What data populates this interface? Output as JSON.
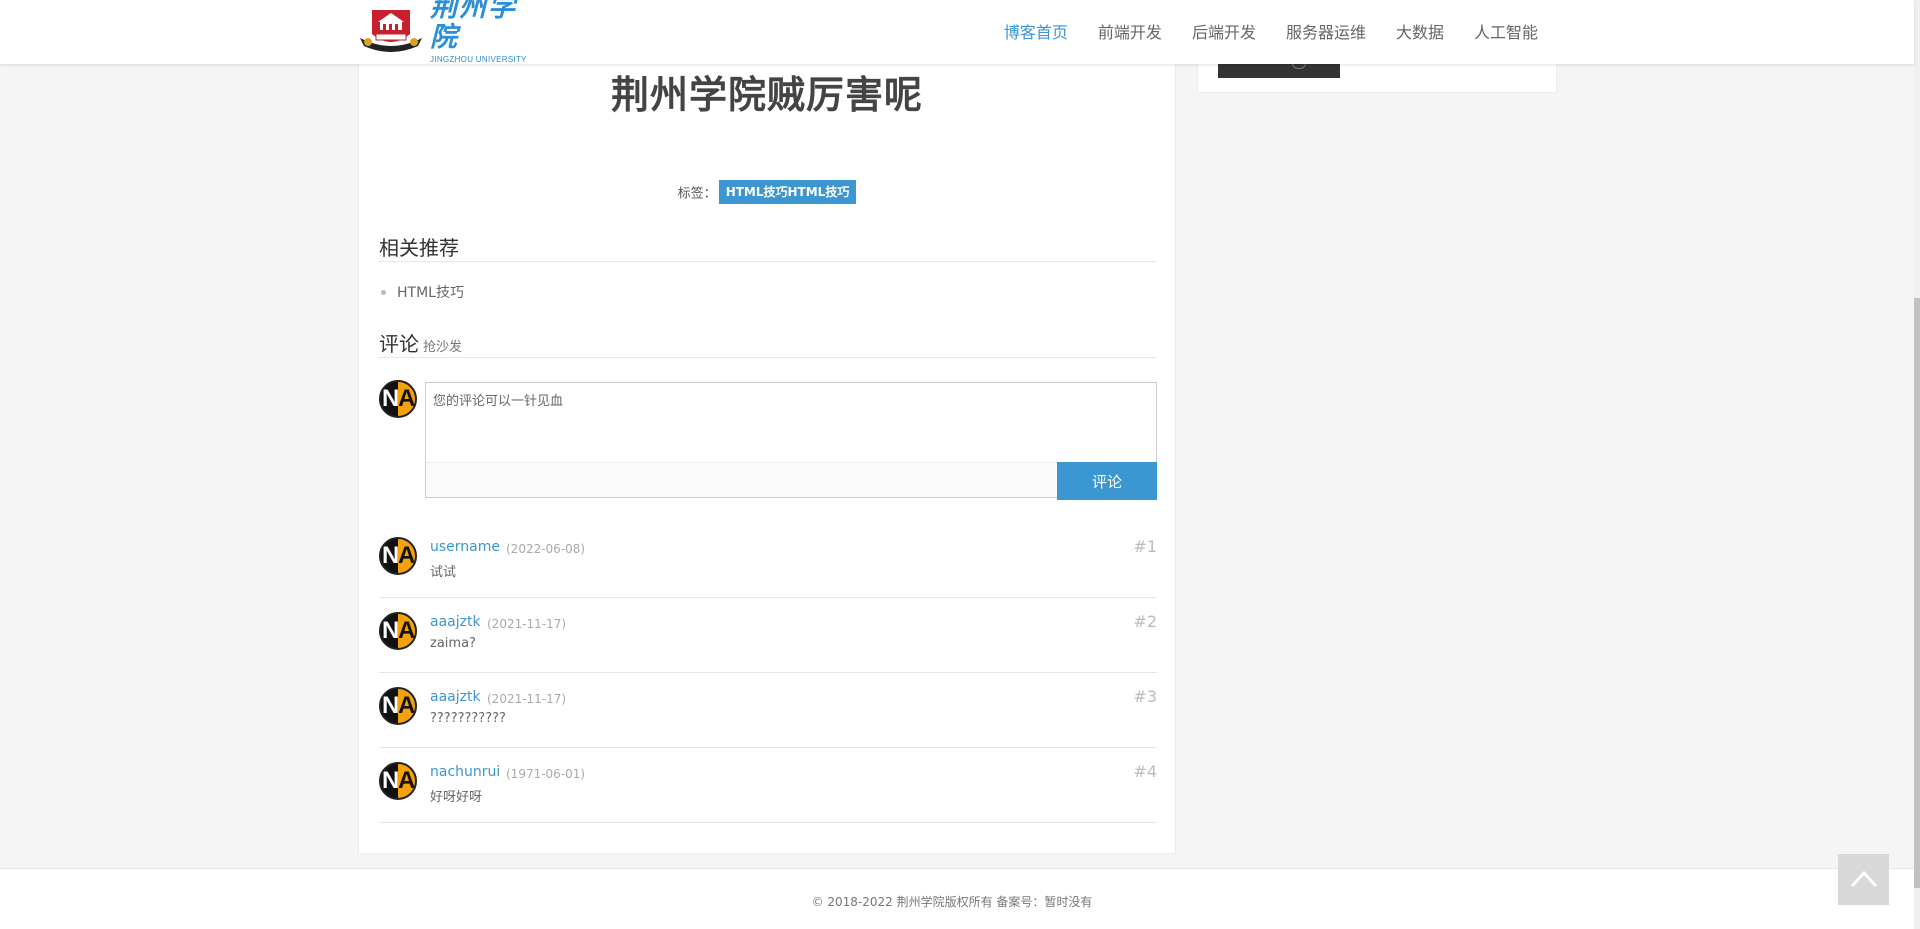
{
  "header": {
    "logo": {
      "cn": "荆州学院",
      "en": "JINGZHOU UNIVERSITY"
    },
    "nav": [
      {
        "label": "博客首页",
        "active": true
      },
      {
        "label": "前端开发",
        "active": false
      },
      {
        "label": "后端开发",
        "active": false
      },
      {
        "label": "服务器运维",
        "active": false
      },
      {
        "label": "大数据",
        "active": false
      },
      {
        "label": "人工智能",
        "active": false
      }
    ]
  },
  "article": {
    "title": "荆州学院贼厉害呢",
    "tags_label": "标签：",
    "tag": "HTML技巧HTML技巧"
  },
  "related": {
    "heading": "相关推荐",
    "items": [
      "HTML技巧"
    ]
  },
  "comments": {
    "heading": "评论",
    "subheading": "抢沙发",
    "placeholder": "您的评论可以一针见血",
    "submit_label": "评论",
    "avatar_text": {
      "n": "N",
      "a": "A"
    },
    "list": [
      {
        "user": "username",
        "date": "(2022-06-08)",
        "text": "试试",
        "num": "#1"
      },
      {
        "user": "aaajztk",
        "date": "(2021-11-17)",
        "text": "zaima?",
        "num": "#2"
      },
      {
        "user": "aaajztk",
        "date": "(2021-11-17)",
        "text": "???????????",
        "num": "#3"
      },
      {
        "user": "nachunrui",
        "date": "(1971-06-01)",
        "text": "好呀好呀",
        "num": "#4"
      }
    ]
  },
  "footer": {
    "text": "© 2018-2022 荆州学院版权所有    备案号：暂时没有"
  },
  "colors": {
    "accent": "#3b96d1",
    "logo": "#2b8fd8"
  },
  "icons": {
    "back_to_top": "chevron-up-icon"
  }
}
